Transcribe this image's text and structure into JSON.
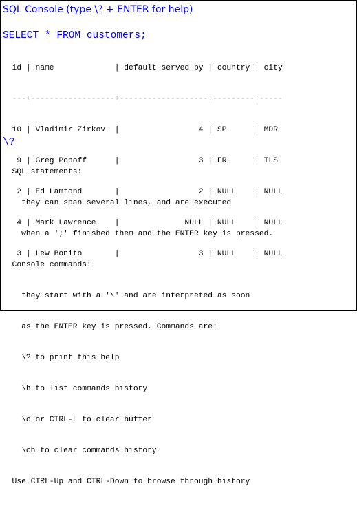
{
  "header": {
    "title": "SQL Console (type \\? + ENTER for help)"
  },
  "query": {
    "command": "SELECT * FROM customers;"
  },
  "table": {
    "header_line": "  id | name             | default_served_by | country | city",
    "separator_line": "  ---+------------------+-------------------+---------+-----",
    "rows": [
      "  10 | Vladimir Zirkov  |                 4 | SP      | MDR",
      "   9 | Greg Popoff      |                 3 | FR      | TLS",
      "   2 | Ed Lamtond       |                 2 | NULL    | NULL",
      "   4 | Mark Lawrence    |              NULL | NULL    | NULL",
      "   3 | Lew Bonito       |                 3 | NULL    | NULL"
    ]
  },
  "help_cmd": {
    "command": "\\?"
  },
  "help": {
    "lines": [
      "  SQL statements:",
      "    they can span several lines, and are executed",
      "    when a ';' finished them and the ENTER key is pressed.",
      "  Console commands:",
      "    they start with a '\\' and are interpreted as soon",
      "    as the ENTER key is pressed. Commands are:",
      "    \\? to print this help",
      "    \\h to list commands history",
      "    \\c or CTRL-L to clear buffer",
      "    \\ch to clear commands history",
      "  Use CTRL-Up and CTRL-Down to browse through history"
    ]
  }
}
